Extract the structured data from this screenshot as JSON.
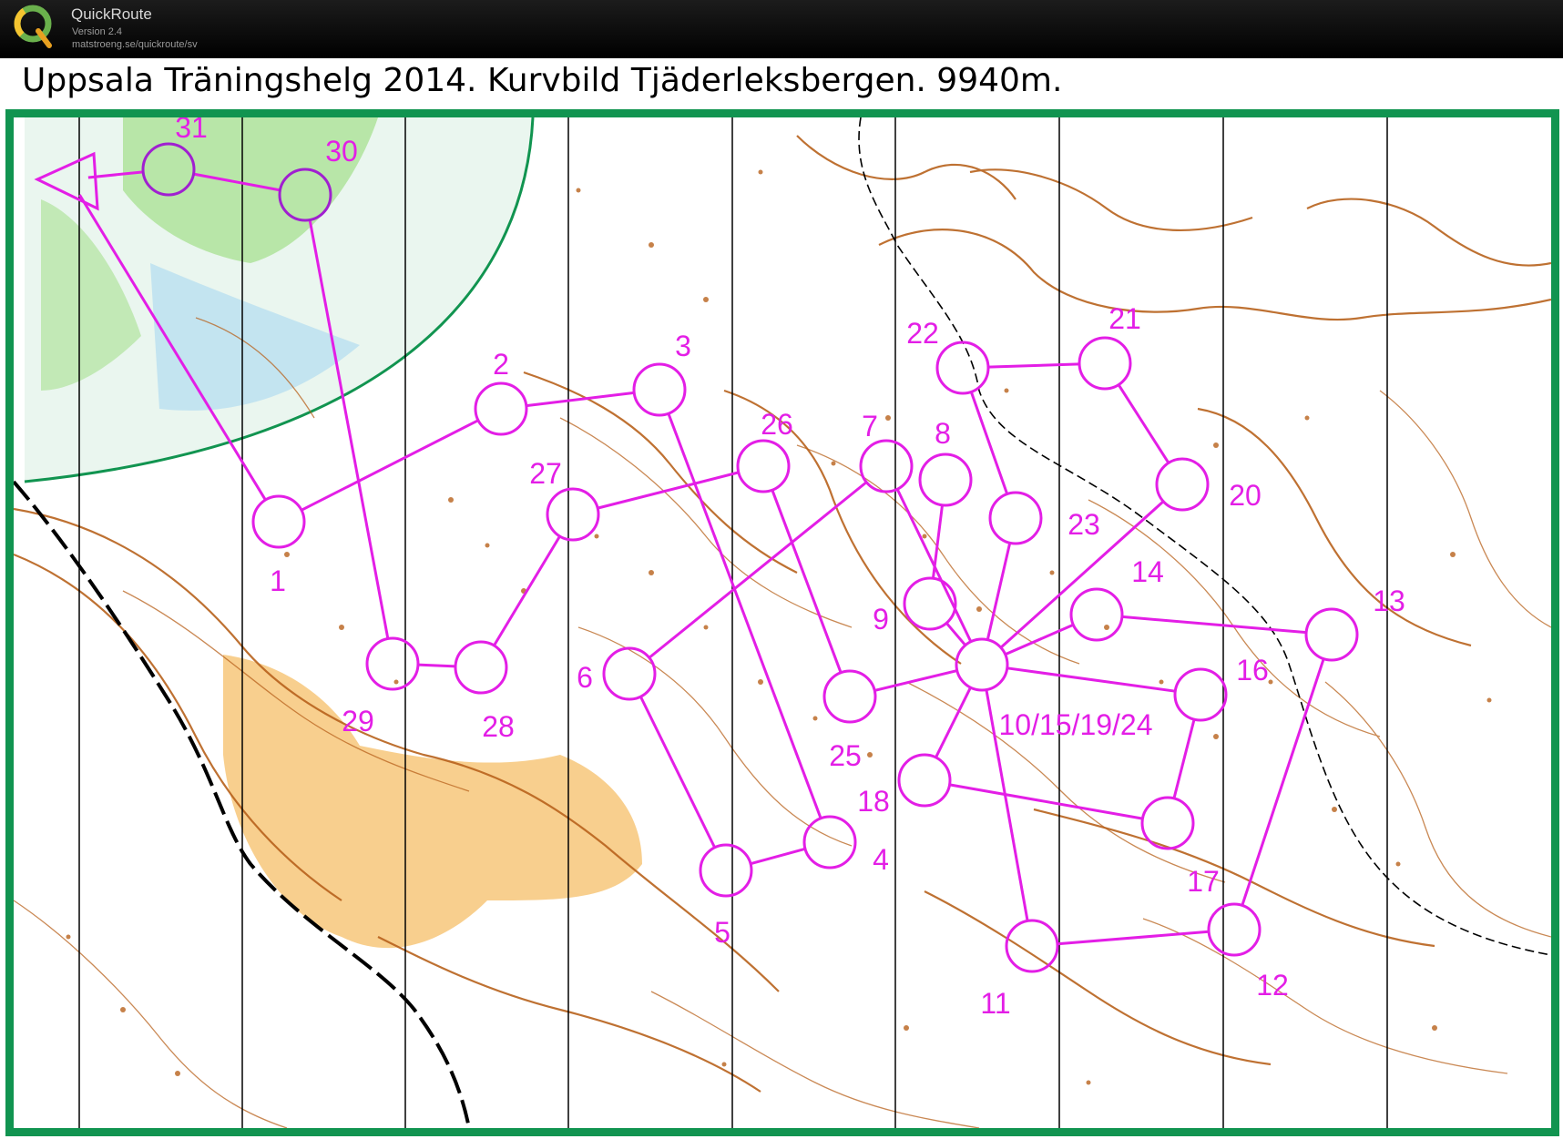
{
  "app": {
    "name": "QuickRoute",
    "version": "Version 2.4",
    "url": "matstroeng.se/quickroute/sv",
    "logo_letter": "Q"
  },
  "map": {
    "title": "Uppsala Träningshelg 2014. Kurvbild Tjäderleksbergen. 9940m.",
    "course_color": "#e31ee6",
    "contour_color": "#b8621c",
    "frame_color": "#119450",
    "controls": [
      {
        "label": "31"
      },
      {
        "label": "30"
      },
      {
        "label": "1"
      },
      {
        "label": "2"
      },
      {
        "label": "3"
      },
      {
        "label": "26"
      },
      {
        "label": "27"
      },
      {
        "label": "7"
      },
      {
        "label": "8"
      },
      {
        "label": "22"
      },
      {
        "label": "21"
      },
      {
        "label": "20"
      },
      {
        "label": "23"
      },
      {
        "label": "9"
      },
      {
        "label": "14"
      },
      {
        "label": "13"
      },
      {
        "label": "10/15/19/24"
      },
      {
        "label": "16"
      },
      {
        "label": "6"
      },
      {
        "label": "25"
      },
      {
        "label": "18"
      },
      {
        "label": "17"
      },
      {
        "label": "4"
      },
      {
        "label": "5"
      },
      {
        "label": "29"
      },
      {
        "label": "28"
      },
      {
        "label": "11"
      },
      {
        "label": "12"
      }
    ]
  }
}
